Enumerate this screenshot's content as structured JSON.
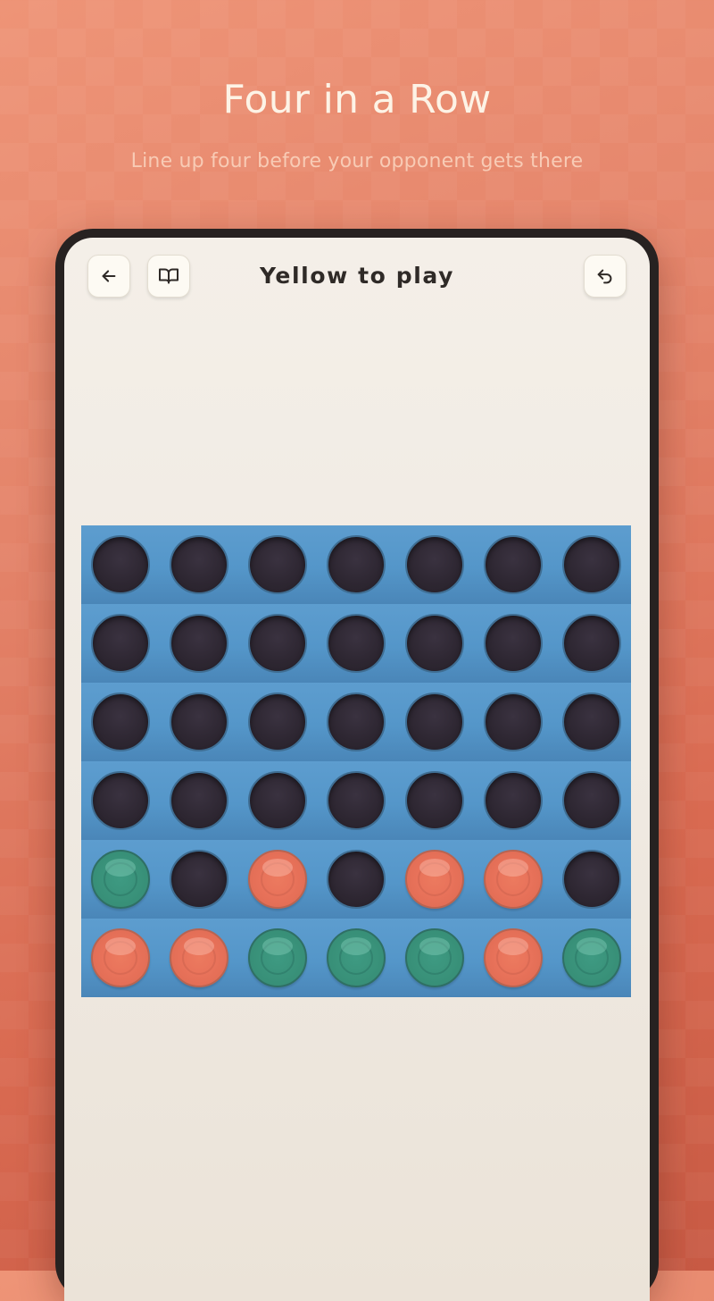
{
  "header": {
    "title": "Four in a Row",
    "subtitle": "Line up four before your opponent gets there"
  },
  "toolbar": {
    "back_icon": "arrow-left-icon",
    "rules_icon": "book-icon",
    "undo_icon": "undo-icon"
  },
  "status": {
    "text": "Yellow to play"
  },
  "colors": {
    "background": "#e4846a",
    "board": "#5496c9",
    "empty_slot": "#2d2631",
    "player_green": "#3a937b",
    "player_orange": "#e8725a",
    "device_frame": "#272221"
  },
  "board": {
    "columns": 7,
    "rows": 6,
    "grid": [
      [
        "empty",
        "empty",
        "empty",
        "empty",
        "empty",
        "empty",
        "empty"
      ],
      [
        "empty",
        "empty",
        "empty",
        "empty",
        "empty",
        "empty",
        "empty"
      ],
      [
        "empty",
        "empty",
        "empty",
        "empty",
        "empty",
        "empty",
        "empty"
      ],
      [
        "empty",
        "empty",
        "empty",
        "empty",
        "empty",
        "empty",
        "empty"
      ],
      [
        "green",
        "empty",
        "orange",
        "empty",
        "orange",
        "orange",
        "empty"
      ],
      [
        "orange",
        "orange",
        "green",
        "green",
        "green",
        "orange",
        "green"
      ]
    ]
  }
}
